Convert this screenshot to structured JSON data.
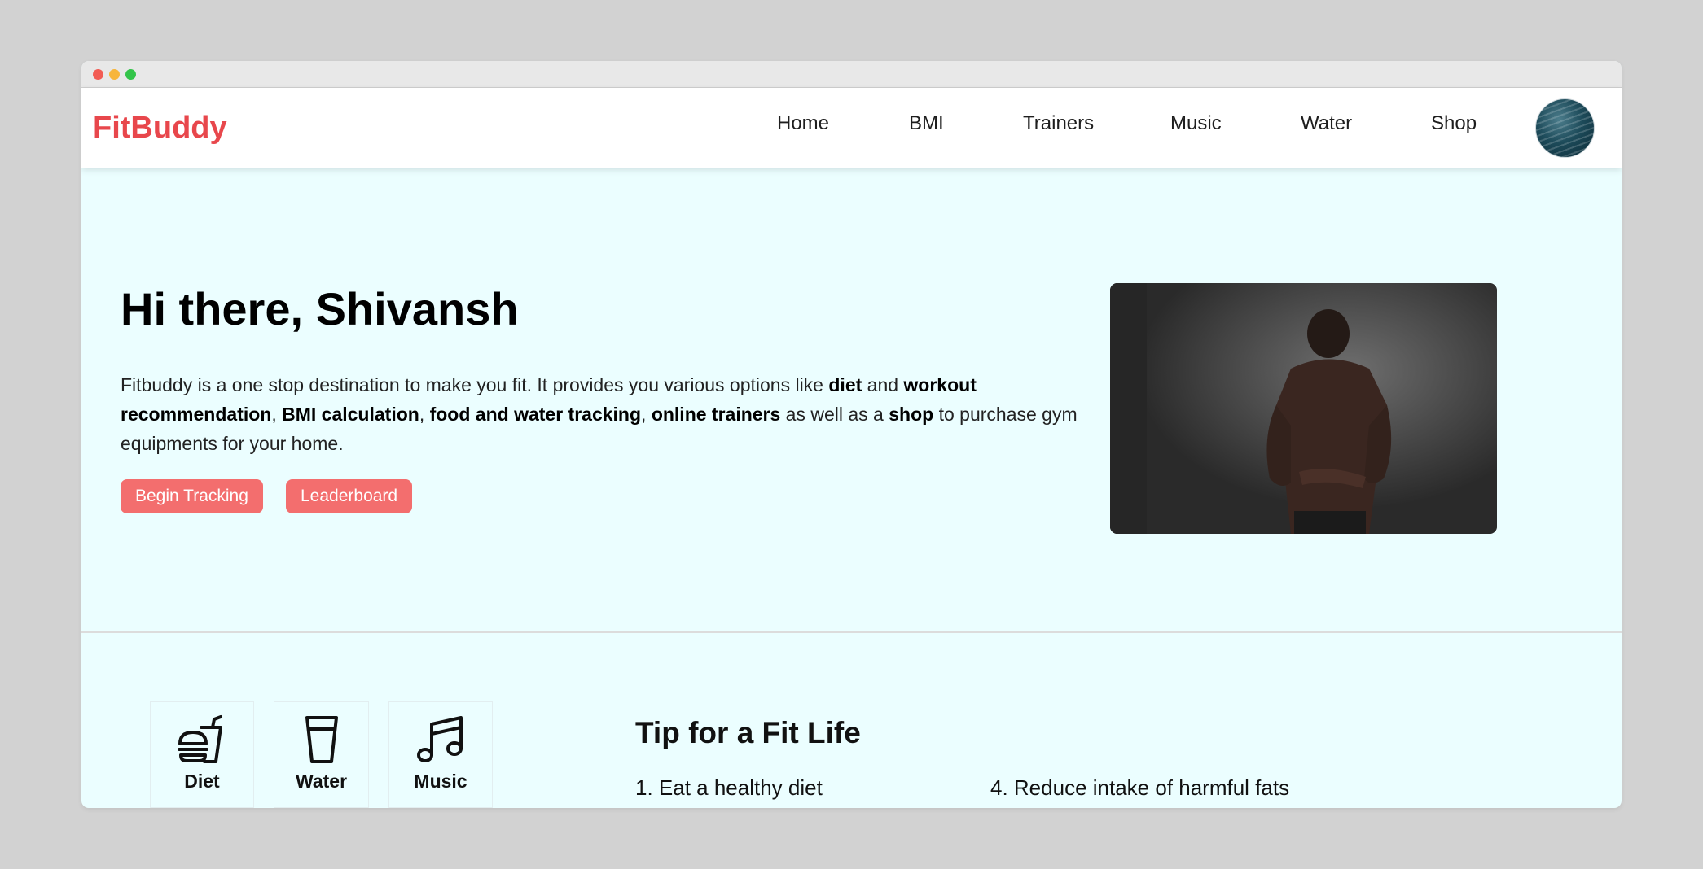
{
  "brand": {
    "name": "FitBuddy",
    "color": "#e8474c"
  },
  "nav": {
    "items": [
      "Home",
      "BMI",
      "Trainers",
      "Music",
      "Water",
      "Shop"
    ],
    "avatar_icon": "profile-avatar"
  },
  "hero": {
    "greeting": "Hi there, Shivansh",
    "desc": {
      "p1": "Fitbuddy is a one stop destination to make you fit. It provides you various options like ",
      "b1": "diet",
      "p2": " and ",
      "b2": "workout recommendation",
      "p3": ", ",
      "b3": "BMI calculation",
      "p4": ", ",
      "b4": "food and water tracking",
      "p5": ", ",
      "b5": "online trainers",
      "p6": " as well as a ",
      "b6": "shop",
      "p7": " to purchase gym equipments for your home."
    },
    "buttons": {
      "begin_tracking": "Begin Tracking",
      "leaderboard": "Leaderboard"
    },
    "button_color": "#f36e6e"
  },
  "features": [
    {
      "label": "Diet",
      "icon": "fast-food-icon"
    },
    {
      "label": "Water",
      "icon": "glass-icon"
    },
    {
      "label": "Music",
      "icon": "music-note-icon"
    }
  ],
  "tips": {
    "title": "Tip for a Fit Life",
    "items": [
      "1. Eat a healthy diet",
      "4. Reduce intake of harmful fats"
    ]
  },
  "colors": {
    "page_background": "#ebfeff",
    "navbar_background": "#ffffff"
  }
}
